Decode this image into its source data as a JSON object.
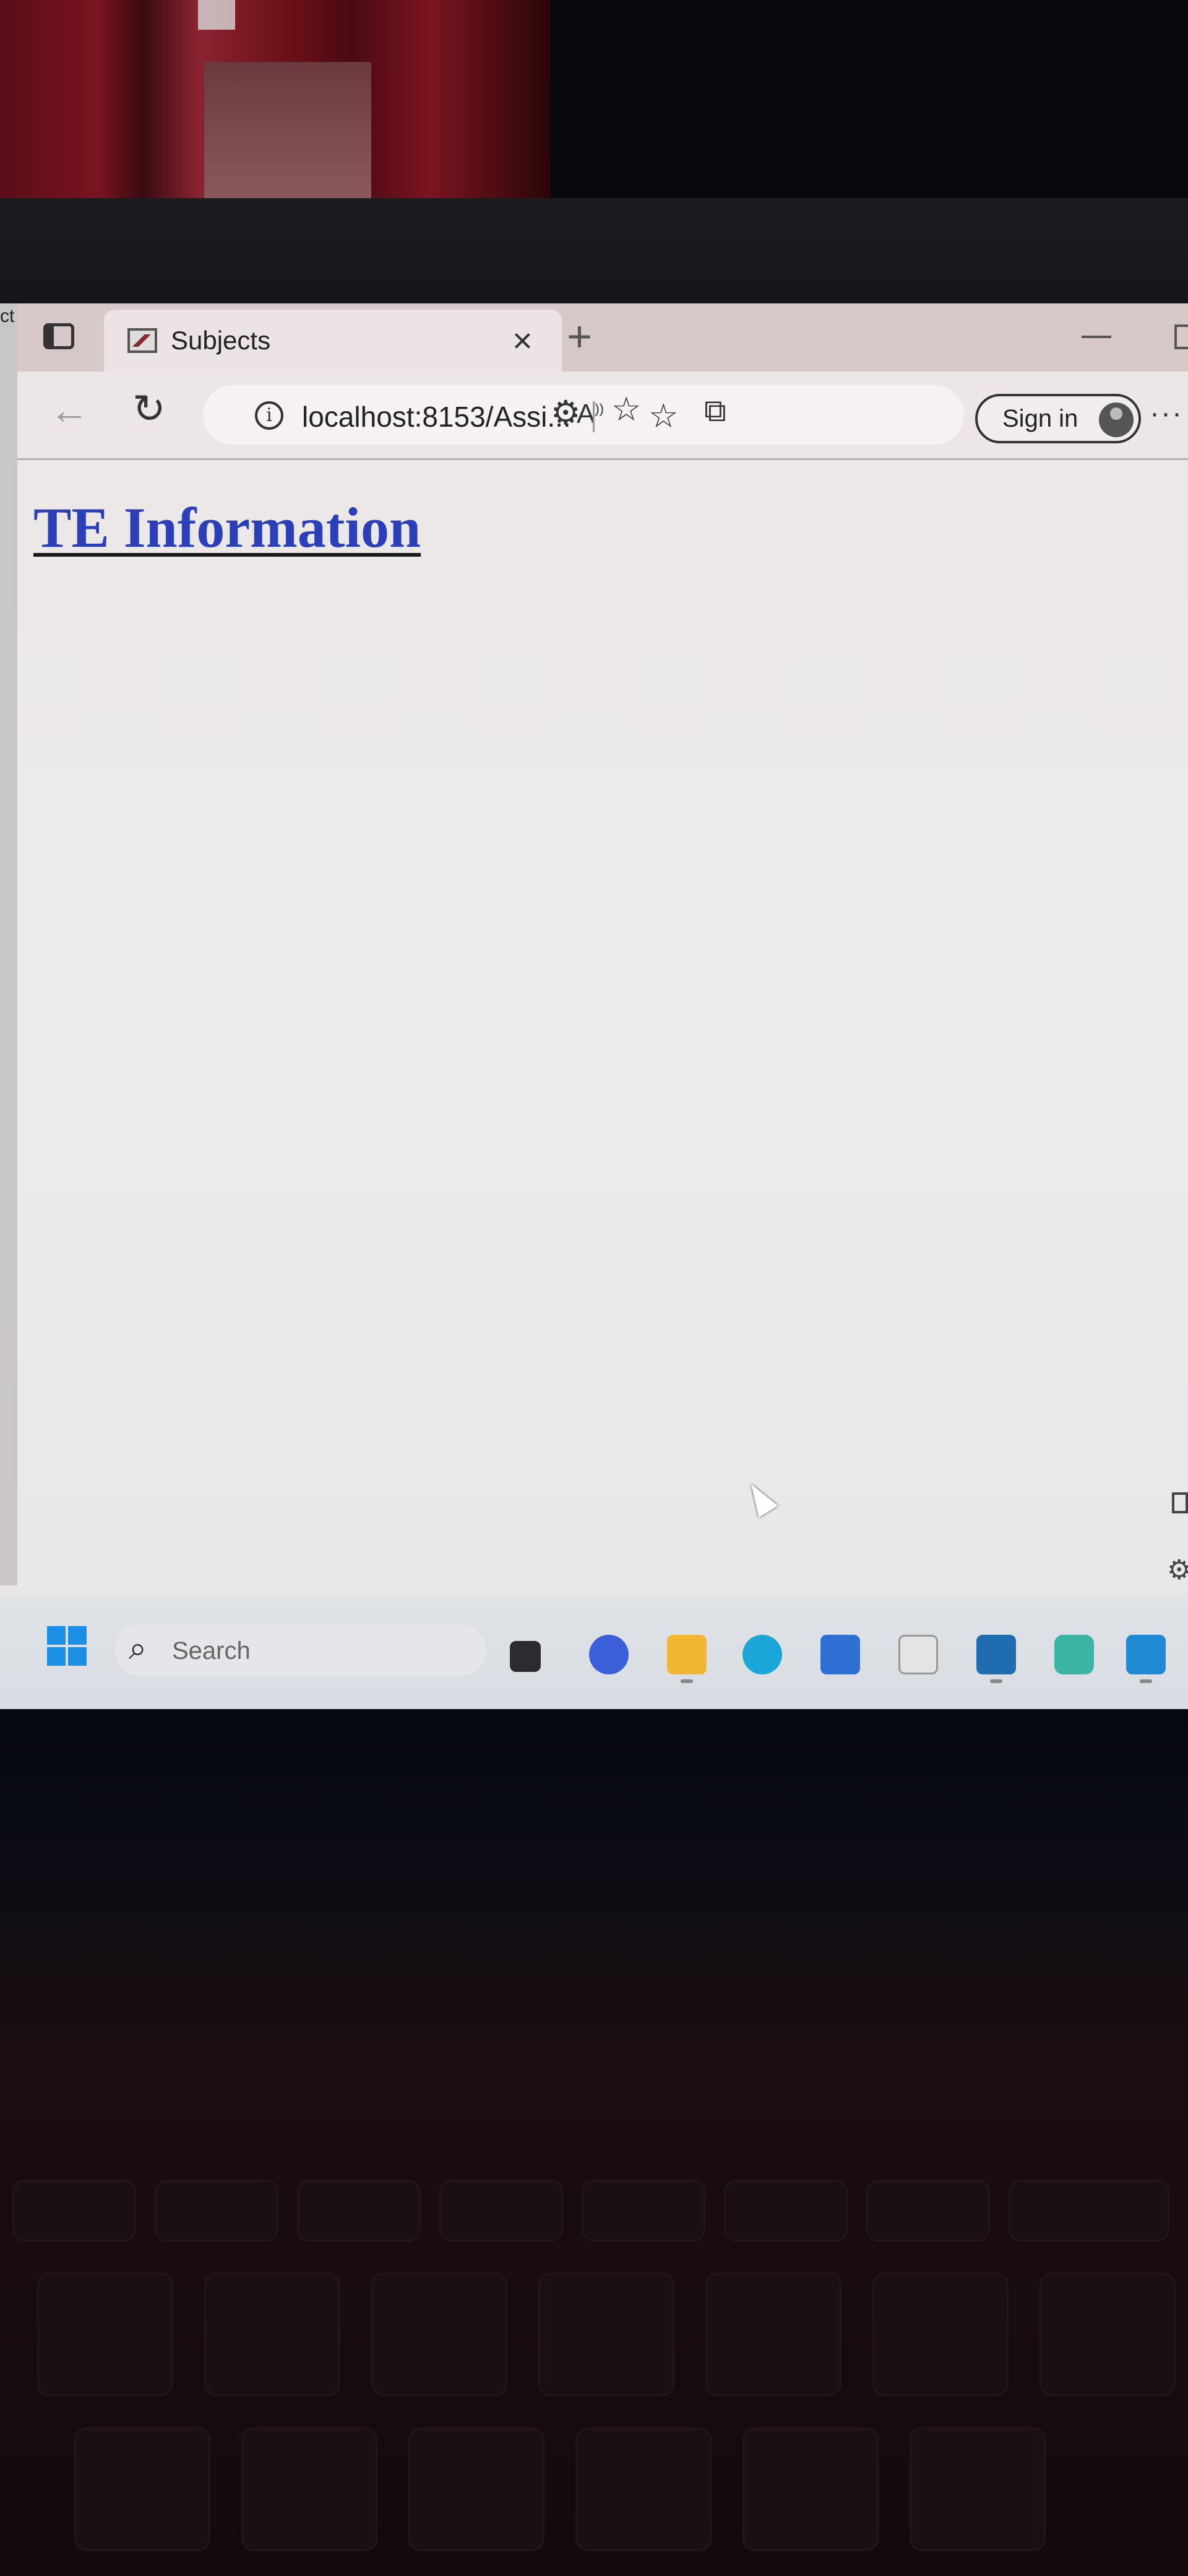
{
  "browser": {
    "tab": {
      "title": "Subjects",
      "close_glyph": "×"
    },
    "new_tab_glyph": "+",
    "toolbar": {
      "back_glyph": "←",
      "reload_glyph": "↻",
      "url": "localhost:8153/Assi...",
      "read_aloud_glyph": "A",
      "signin_label": "Sign in",
      "more_glyph": "···"
    }
  },
  "page": {
    "heading": "TE Information"
  },
  "left_strip": {
    "text": "ct"
  },
  "taskbar": {
    "search_placeholder": "Search",
    "apps": [
      {
        "icon": "file-explorer-icon",
        "color": "#f2b632"
      },
      {
        "icon": "teams-icon",
        "color": "#5b5fc7"
      },
      {
        "icon": "edge-icon",
        "color": "#1aa7d8"
      },
      {
        "icon": "vscode-icon",
        "color": "#1f8ad2"
      }
    ]
  },
  "colors": {
    "heading_link": "#2a3fb8",
    "start_blue": "#1b8ee6"
  }
}
